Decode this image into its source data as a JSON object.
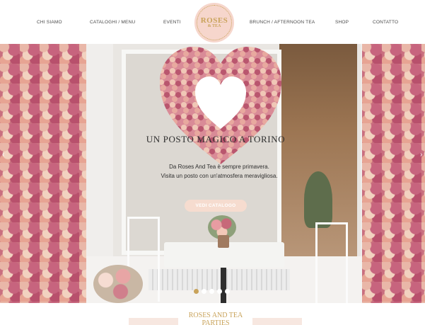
{
  "nav": {
    "items": [
      "CHI SIAMO",
      "CATALOGHI / MENU",
      "EVENTI",
      "BRUNCH / AFTERNOON TEA",
      "SHOP",
      "CONTATTO"
    ]
  },
  "logo": {
    "line1": "ROSES",
    "line2": "& TEA"
  },
  "hero": {
    "title": "UN POSTO MAGICO A TORINO",
    "line1": "Da Roses And Tea è sempre primavera.",
    "line2": "Visita un posto con un'atmosfera meravigliosa.",
    "button": "VEDI CATALOGO",
    "slides": 5,
    "active_slide": 1
  },
  "section": {
    "title_line1": "ROSES AND TEA",
    "title_line2": "PARTIES"
  },
  "colors": {
    "accent_gold": "#c9a35a",
    "logo_pink": "#f6d6cc",
    "button_pink": "#f6dccf"
  },
  "icons": {
    "prev": "chevron-left-icon",
    "next": "chevron-right-icon"
  }
}
